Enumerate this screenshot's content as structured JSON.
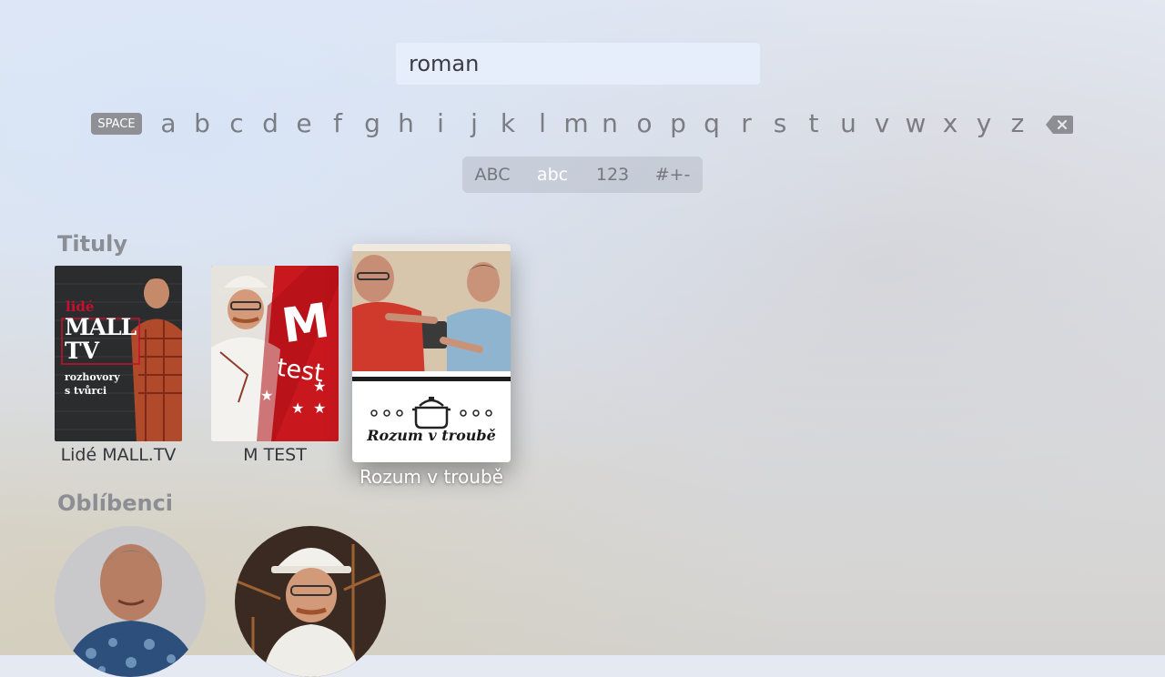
{
  "search": {
    "query": "roman"
  },
  "keyboard": {
    "space_label": "SPACE",
    "letters": [
      "a",
      "b",
      "c",
      "d",
      "e",
      "f",
      "g",
      "h",
      "i",
      "j",
      "k",
      "l",
      "m",
      "n",
      "o",
      "p",
      "q",
      "r",
      "s",
      "t",
      "u",
      "v",
      "w",
      "x",
      "y",
      "z"
    ],
    "delete_icon": "delete-backward-icon",
    "modes": [
      "ABC",
      "abc",
      "123",
      "#+-"
    ],
    "active_mode": "abc"
  },
  "sections": {
    "titles": {
      "heading": "Tituly",
      "items": [
        {
          "caption": "Lidé MALL.TV",
          "poster_text": [
            "lidé",
            "MALL",
            "TV",
            "rozhovory",
            "s tvůrci"
          ]
        },
        {
          "caption": "M TEST",
          "poster_text": [
            "M",
            "test"
          ]
        },
        {
          "caption": "Rozum v troubě",
          "poster_text": [
            "Rozum v troubě"
          ],
          "focused": true
        }
      ]
    },
    "favorites": {
      "heading": "Oblíbenci"
    }
  },
  "colors": {
    "space_key_bg": "#8f9095",
    "mall_red": "#c8102e",
    "mtest_red": "#c9171e"
  }
}
